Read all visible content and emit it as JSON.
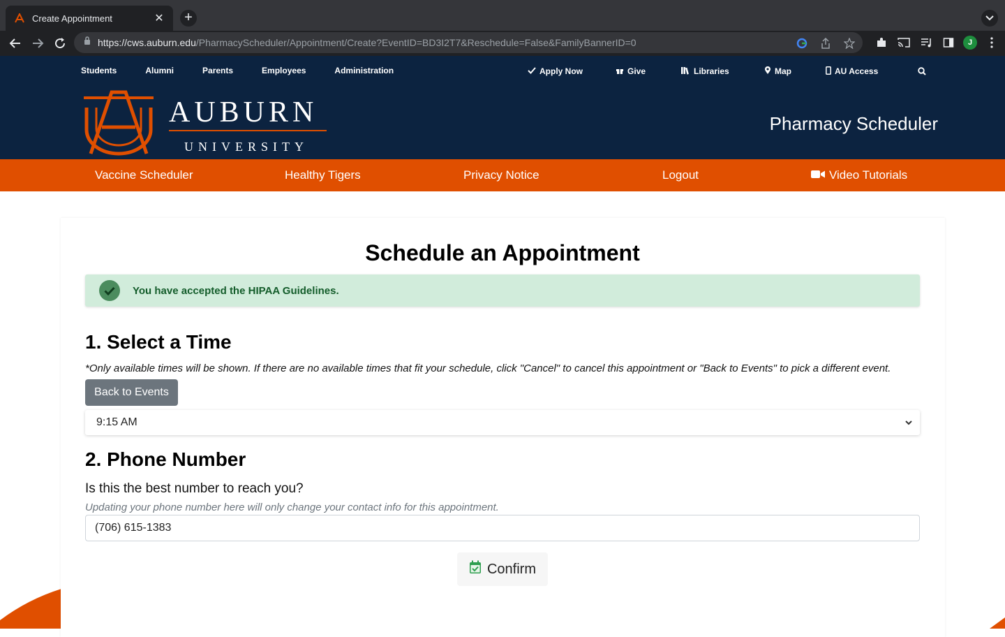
{
  "browser": {
    "tab_title": "Create Appointment",
    "url_host": "https://cws.auburn.edu",
    "url_path": "/PharmacyScheduler/Appointment/Create?EventID=BD3I2T7&Reschedule=False&FamilyBannerID=0",
    "profile_initial": "J"
  },
  "utility_nav": {
    "left": [
      "Students",
      "Alumni",
      "Parents",
      "Employees",
      "Administration"
    ],
    "right": [
      {
        "label": "Apply Now",
        "icon": "check-icon"
      },
      {
        "label": "Give",
        "icon": "gift-icon"
      },
      {
        "label": "Libraries",
        "icon": "books-icon"
      },
      {
        "label": "Map",
        "icon": "map-pin-icon"
      },
      {
        "label": "AU Access",
        "icon": "mobile-icon"
      }
    ]
  },
  "logo": {
    "name_top": "AUBURN",
    "name_bottom": "UNIVERSITY"
  },
  "site_title": "Pharmacy Scheduler",
  "main_nav": [
    "Vaccine Scheduler",
    "Healthy Tigers",
    "Privacy Notice",
    "Logout",
    "Video Tutorials"
  ],
  "page": {
    "heading": "Schedule an Appointment",
    "alert": "You have accepted the HIPAA Guidelines.",
    "section1_title": "1. Select a Time",
    "section1_note": "*Only available times will be shown. If there are no available times that fit your schedule, click \"Cancel\" to cancel this appointment or \"Back to Events\" to pick a different event.",
    "back_button": "Back to Events",
    "selected_time": "9:15 AM",
    "section2_title": "2. Phone Number",
    "phone_question": "Is this the best number to reach you?",
    "phone_hint": "Updating your phone number here will only change your contact info for this appointment.",
    "phone_value": "(706) 615-1383",
    "confirm_button": "Confirm"
  },
  "colors": {
    "navy": "#0c2340",
    "orange": "#e04f00",
    "alert_bg": "#d1ecdb",
    "alert_text": "#135c2a",
    "button_grey": "#6c757d"
  }
}
